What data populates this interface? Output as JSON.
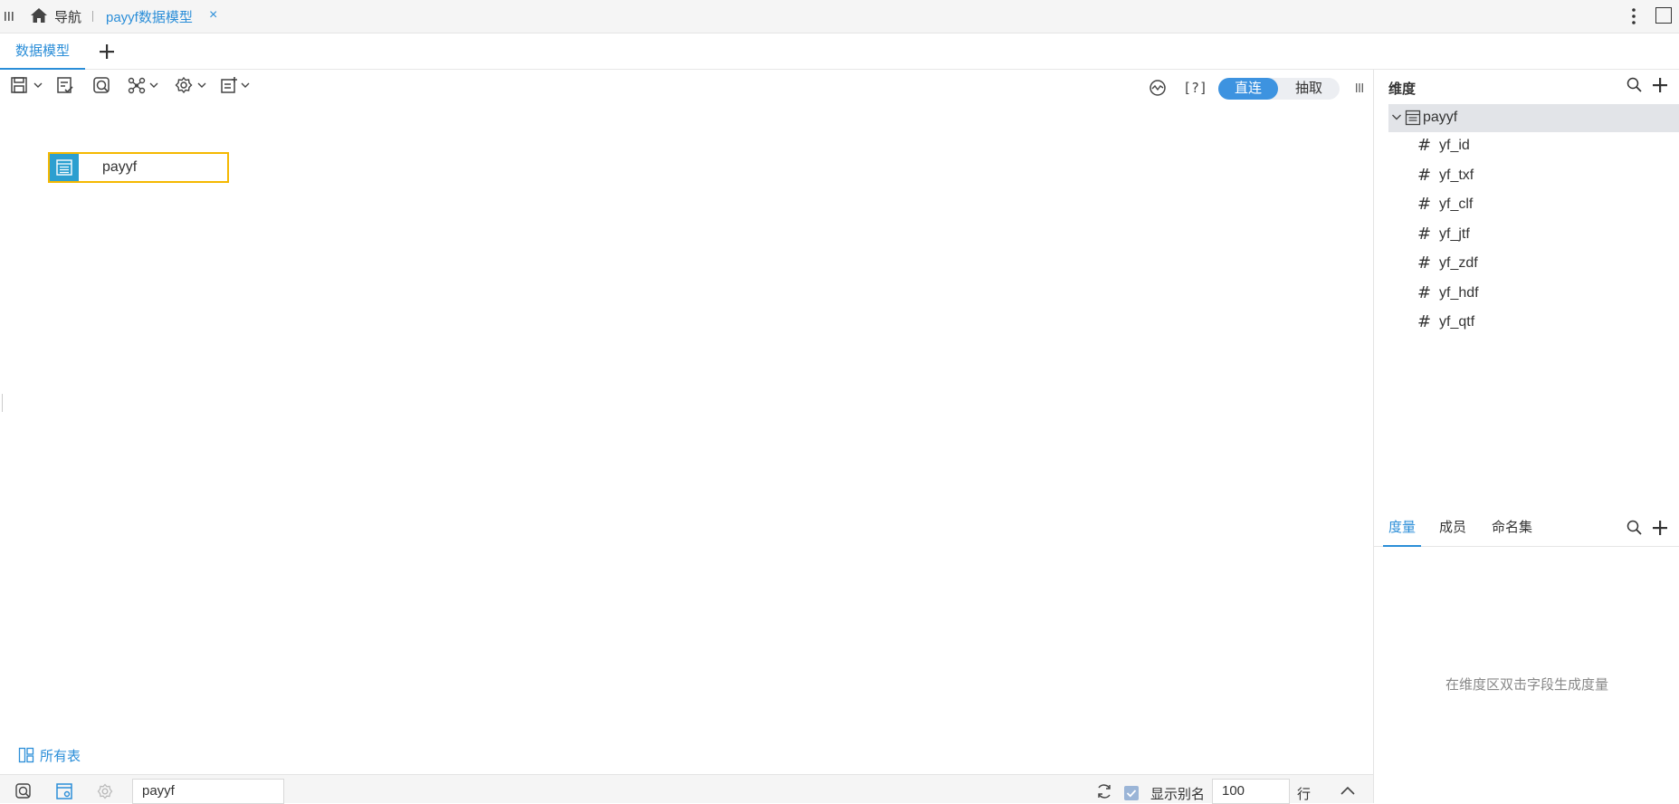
{
  "topbar": {
    "home_label": "导航",
    "doc_tab": "payyf数据模型",
    "close_symbol": "×"
  },
  "subtabs": {
    "active_tab": "数据模型"
  },
  "toolbar": {
    "mode_direct": "直连",
    "mode_extract": "抽取",
    "help_label": "[?]"
  },
  "canvas": {
    "table_node_label": "payyf",
    "all_tables_label": "所有表"
  },
  "bottombar": {
    "table_name_value": "payyf",
    "show_alias_label": "显示别名",
    "show_alias_checked": true,
    "rows_value": "100",
    "rows_unit": "行"
  },
  "dimension_panel": {
    "title": "维度",
    "root": "payyf",
    "fields": [
      "yf_id",
      "yf_txf",
      "yf_clf",
      "yf_jtf",
      "yf_zdf",
      "yf_hdf",
      "yf_qtf"
    ]
  },
  "measure_panel": {
    "tabs": [
      "度量",
      "成员",
      "命名集"
    ],
    "active_tab": "度量",
    "empty_hint": "在维度区双击字段生成度量"
  },
  "colors": {
    "accent": "#2b8ed8",
    "node_border": "#f5b800",
    "node_icon_bg": "#2c9fd0"
  }
}
